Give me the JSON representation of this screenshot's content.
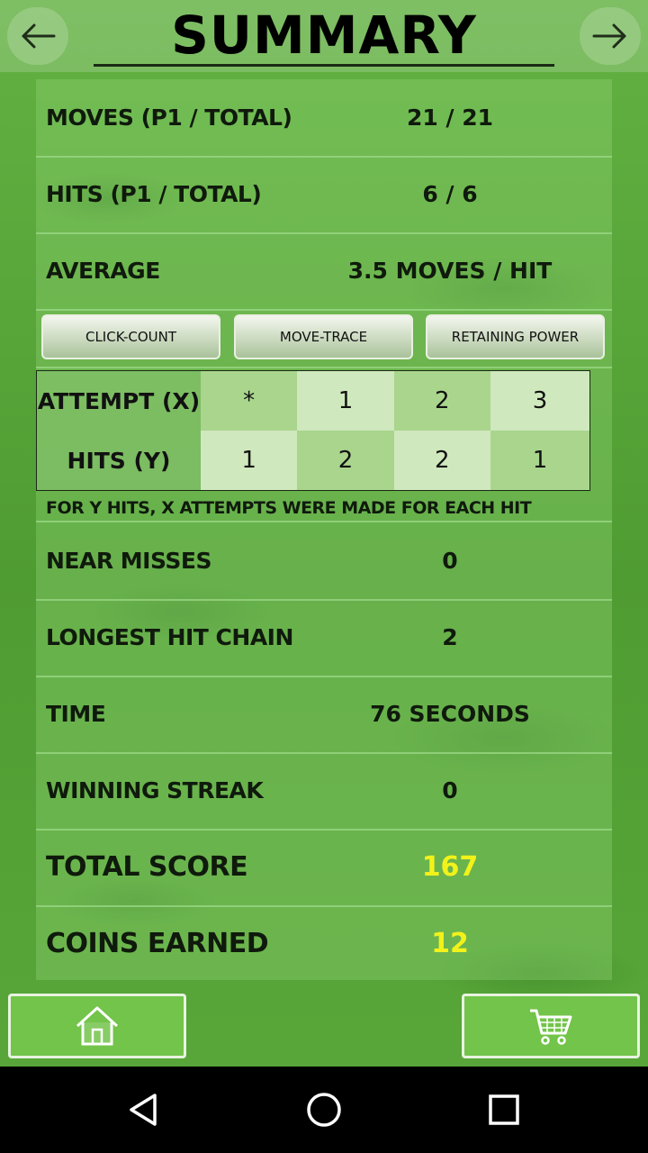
{
  "header": {
    "title": "SUMMARY",
    "back_icon": "arrow-left-icon",
    "forward_icon": "arrow-right-icon"
  },
  "stats_top": [
    {
      "label": "MOVES (P1 / TOTAL)",
      "value": "21 / 21"
    },
    {
      "label": "HITS (P1 / TOTAL)",
      "value": "6 / 6"
    },
    {
      "label": "AVERAGE",
      "value": "3.5 MOVES / HIT"
    }
  ],
  "tabs": [
    {
      "label": "CLICK-COUNT"
    },
    {
      "label": "MOVE-TRACE"
    },
    {
      "label": "RETAINING POWER"
    }
  ],
  "attempts_table": {
    "row_x_label": "ATTEMPT (X)",
    "row_y_label": "HITS (Y)",
    "attempts": [
      "*",
      "1",
      "2",
      "3"
    ],
    "hits": [
      "1",
      "2",
      "2",
      "1"
    ]
  },
  "note": "FOR Y HITS, X ATTEMPTS WERE MADE FOR EACH HIT",
  "stats_bottom": [
    {
      "label": "NEAR MISSES",
      "value": "0"
    },
    {
      "label": "LONGEST HIT CHAIN",
      "value": "2"
    },
    {
      "label": "TIME",
      "value": "76 SECONDS"
    },
    {
      "label": "WINNING STREAK",
      "value": "0"
    }
  ],
  "totals": [
    {
      "label": "TOTAL SCORE",
      "value": "167"
    },
    {
      "label": "COINS EARNED",
      "value": "12"
    }
  ],
  "footer": {
    "home_icon": "home-icon",
    "cart_icon": "cart-icon"
  },
  "colors": {
    "accent_yellow": "#f2f21a",
    "button_green": "#73c44a"
  }
}
